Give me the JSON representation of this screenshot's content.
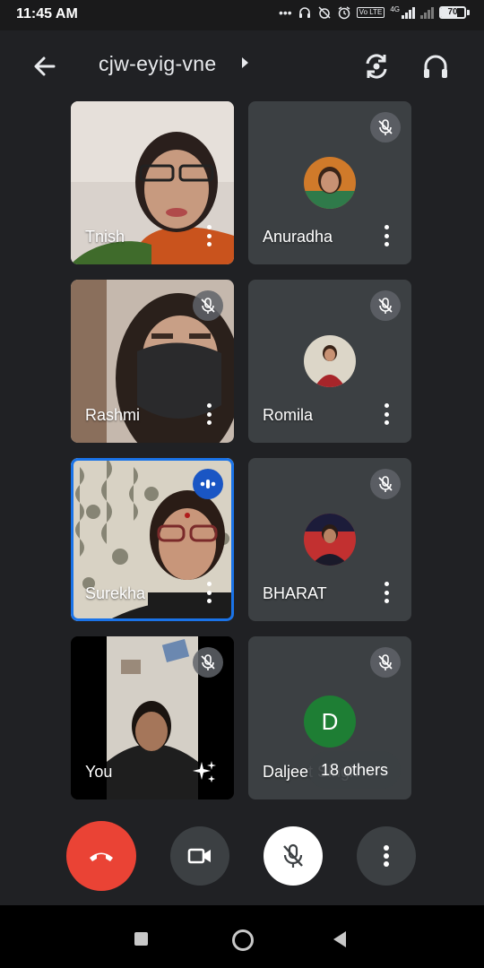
{
  "status_bar": {
    "time": "11:45 AM",
    "volte": "Vo LTE",
    "network": "4G",
    "battery_level": "70",
    "battery_fraction": 0.7,
    "icons": [
      "more-dots-icon",
      "headset-icon",
      "alarm-off-icon",
      "alarm-icon",
      "volte-icon",
      "signal-4g-icon",
      "signal-icon",
      "battery-icon"
    ]
  },
  "header": {
    "meeting_code": "cjw-eyig-vne"
  },
  "participants": [
    {
      "name": "Tnish",
      "muted": false,
      "video": true
    },
    {
      "name": "Anuradha",
      "muted": true,
      "video": false
    },
    {
      "name": "Rashmi",
      "muted": true,
      "video": true
    },
    {
      "name": "Romila",
      "muted": true,
      "video": false
    },
    {
      "name": "Surekha",
      "muted": false,
      "video": true,
      "speaking": true
    },
    {
      "name": "BHARAT",
      "muted": true,
      "video": false
    },
    {
      "name": "You",
      "muted": true,
      "video": true
    },
    {
      "name": "Daljeet Singh",
      "muted": true,
      "video": false,
      "initial": "D"
    }
  ],
  "others_label": "18 others",
  "controls": {
    "end_call": "end-call-icon",
    "camera": "camera-icon",
    "mic": "mic-off-icon",
    "more": "more-vert-icon"
  },
  "colors": {
    "background": "#202124",
    "tile": "#3c4043",
    "end_call": "#ea4335",
    "speaking_border": "#1a73e8",
    "avatar_d": "#1e7e34"
  }
}
